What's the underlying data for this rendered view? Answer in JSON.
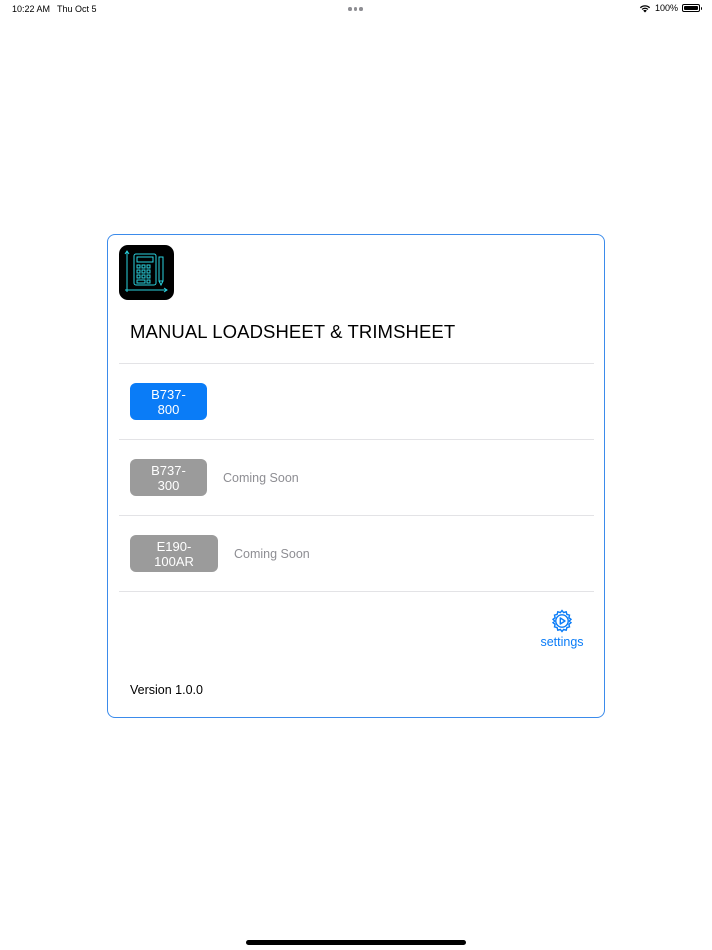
{
  "status_bar": {
    "time": "10:22 AM",
    "date": "Thu Oct 5",
    "battery": "100%",
    "icons": [
      "wifi-icon",
      "battery-icon",
      "multitasking-dots-icon"
    ]
  },
  "app": {
    "icon": "calculator-chart-icon",
    "title": "MANUAL LOADSHEET & TRIMSHEET",
    "version": "Version 1.0.0",
    "accent_color": "#0a7cf7",
    "border_color": "#3b8beb"
  },
  "aircraft": [
    {
      "label": "B737-800",
      "status": "",
      "enabled": true
    },
    {
      "label": "B737-300",
      "status": "Coming Soon",
      "enabled": false
    },
    {
      "label": "E190-100AR",
      "status": "Coming Soon",
      "enabled": false
    }
  ],
  "settings": {
    "label": "settings",
    "icon": "gear-icon"
  }
}
